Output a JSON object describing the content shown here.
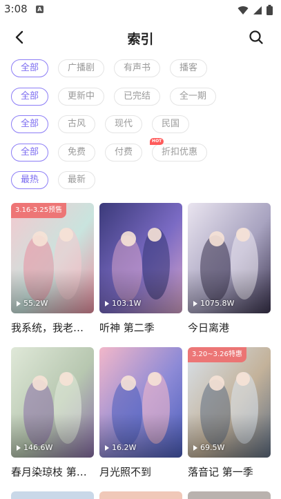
{
  "status": {
    "time": "3:08"
  },
  "header": {
    "title": "索引"
  },
  "filters": [
    {
      "chips": [
        {
          "label": "全部",
          "active": true
        },
        {
          "label": "广播剧"
        },
        {
          "label": "有声书"
        },
        {
          "label": "播客"
        }
      ]
    },
    {
      "chips": [
        {
          "label": "全部",
          "active": true
        },
        {
          "label": "更新中"
        },
        {
          "label": "已完结"
        },
        {
          "label": "全一期"
        }
      ]
    },
    {
      "chips": [
        {
          "label": "全部",
          "active": true
        },
        {
          "label": "古风"
        },
        {
          "label": "现代"
        },
        {
          "label": "民国"
        }
      ]
    },
    {
      "chips": [
        {
          "label": "全部",
          "active": true
        },
        {
          "label": "免费"
        },
        {
          "label": "付费"
        },
        {
          "label": "折扣优惠",
          "badge": "HOT"
        }
      ]
    },
    {
      "chips": [
        {
          "label": "最热",
          "active": true
        },
        {
          "label": "最新"
        }
      ]
    }
  ],
  "cards": [
    {
      "title": "我系统，我老…",
      "plays": "55.2W",
      "promo": "3.16-3.25预售",
      "palette": [
        "#f3c9cf",
        "#c9e4de",
        "#e98fa0"
      ]
    },
    {
      "title": "听神 第二季",
      "plays": "103.1W",
      "promo": "",
      "palette": [
        "#3b3a7a",
        "#7b6bc4",
        "#d6a3c8"
      ]
    },
    {
      "title": "今日离港",
      "plays": "1075.8W",
      "promo": "",
      "palette": [
        "#e9e4ef",
        "#a8a3c0",
        "#3c3550"
      ]
    },
    {
      "title": "春月染琼枝 第…",
      "plays": "146.6W",
      "promo": "",
      "palette": [
        "#dfe8d8",
        "#b7c7b0",
        "#8a6fa8"
      ]
    },
    {
      "title": "月光照不到",
      "plays": "16.2W",
      "promo": "",
      "palette": [
        "#f2b7c9",
        "#8d8ad6",
        "#4a5dbb"
      ]
    },
    {
      "title": "落音记 第一季",
      "plays": "69.5W",
      "promo": "3.20~3.26特惠",
      "palette": [
        "#d8e1ea",
        "#c3b29a",
        "#5f6e82"
      ]
    }
  ]
}
